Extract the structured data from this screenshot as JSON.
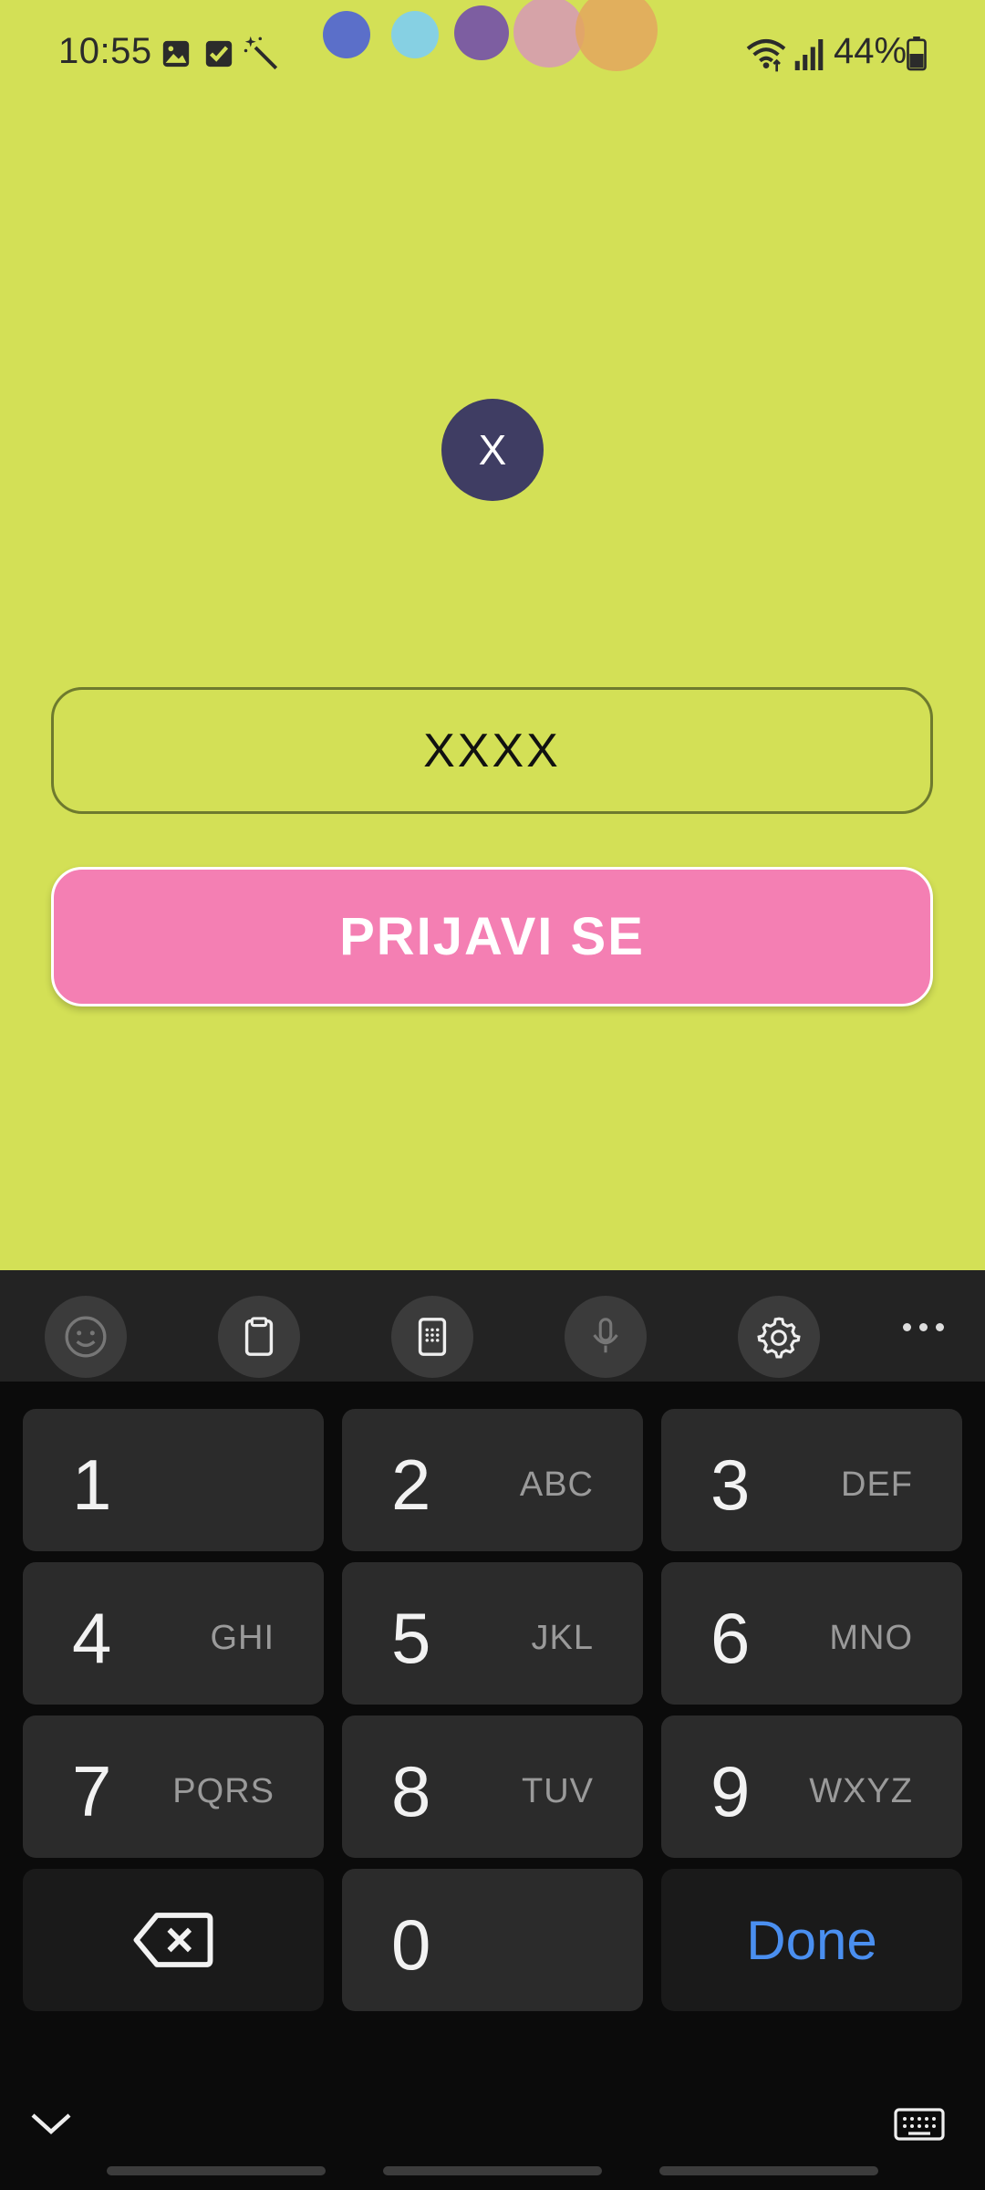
{
  "status_bar": {
    "time": "10:55",
    "battery": "44%",
    "icons": [
      "gallery-icon",
      "checkbox-icon",
      "magic-wand-icon",
      "wifi-icon",
      "signal-icon",
      "battery-icon"
    ],
    "dot_colors": [
      "#5b6fc9",
      "#86d0e3",
      "#7d5ea1",
      "#d6a3a8",
      "#e3a65e"
    ]
  },
  "app": {
    "avatar_letter": "X",
    "pin_value": "XXXX",
    "login_button": "PRIJAVI SE",
    "colors": {
      "background": "#d3e056",
      "button": "#f47fb3",
      "avatar": "#3f3d63"
    }
  },
  "keyboard": {
    "toolbar": [
      "emoji-icon",
      "clipboard-icon",
      "keypad-icon",
      "microphone-icon",
      "settings-icon",
      "more-icon"
    ],
    "keys": [
      {
        "num": "1",
        "letters": ""
      },
      {
        "num": "2",
        "letters": "ABC"
      },
      {
        "num": "3",
        "letters": "DEF"
      },
      {
        "num": "4",
        "letters": "GHI"
      },
      {
        "num": "5",
        "letters": "JKL"
      },
      {
        "num": "6",
        "letters": "MNO"
      },
      {
        "num": "7",
        "letters": "PQRS"
      },
      {
        "num": "8",
        "letters": "TUV"
      },
      {
        "num": "9",
        "letters": "WXYZ"
      }
    ],
    "zero": "0",
    "done": "Done",
    "done_color": "#4a8ff0"
  }
}
